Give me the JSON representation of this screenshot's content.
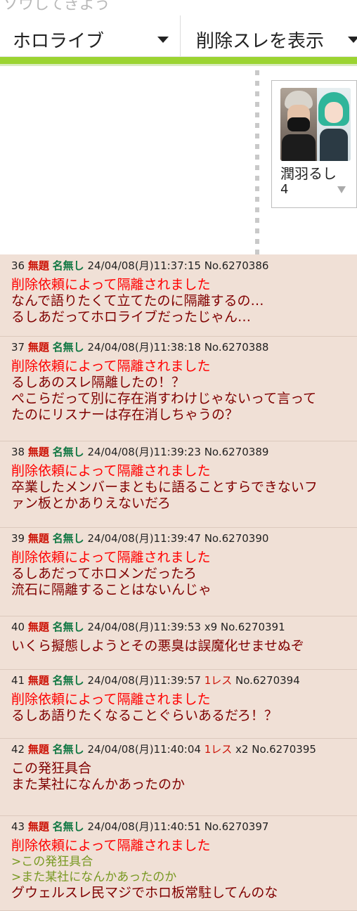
{
  "top_partial_text": "ソウしてきよう",
  "selectors": {
    "board": {
      "label": "ホロライブ"
    },
    "filter": {
      "label": "削除スレを表示"
    }
  },
  "thread_card": {
    "title": "潤羽るし",
    "count": "4"
  },
  "posts": [
    {
      "num": "36",
      "subject": "無題",
      "name": "名無し",
      "datetime": "24/04/08(月)11:37:15",
      "extra": "",
      "postno": "No.6270386",
      "lines": [
        {
          "text": "削除依頼によって隔離されました",
          "type": "warn"
        },
        {
          "text": "なんで語りたくて立てたのに隔離するの…",
          "type": "normal"
        },
        {
          "text": "るしあだってホロライブだったじゃん…",
          "type": "normal"
        }
      ]
    },
    {
      "num": "37",
      "subject": "無題",
      "name": "名無し",
      "datetime": "24/04/08(月)11:38:18",
      "extra": "",
      "postno": "No.6270388",
      "lines": [
        {
          "text": "削除依頼によって隔離されました",
          "type": "warn"
        },
        {
          "text": "るしあのスレ隔離したの！？",
          "type": "normal"
        },
        {
          "text": "ぺこらだって別に存在消すわけじゃないって言って",
          "type": "normal"
        },
        {
          "text": "たのにリスナーは存在消しちゃうの？",
          "type": "normal"
        }
      ]
    },
    {
      "num": "38",
      "subject": "無題",
      "name": "名無し",
      "datetime": "24/04/08(月)11:39:23",
      "extra": "",
      "postno": "No.6270389",
      "lines": [
        {
          "text": "削除依頼によって隔離されました",
          "type": "warn"
        },
        {
          "text": "卒業したメンバーまともに語ることすらできないフ",
          "type": "normal"
        },
        {
          "text": "ァン板とかありえないだろ",
          "type": "normal"
        }
      ]
    },
    {
      "num": "39",
      "subject": "無題",
      "name": "名無し",
      "datetime": "24/04/08(月)11:39:47",
      "extra": "",
      "postno": "No.6270390",
      "lines": [
        {
          "text": "削除依頼によって隔離されました",
          "type": "warn"
        },
        {
          "text": "るしあだってホロメンだったろ",
          "type": "normal"
        },
        {
          "text": "流石に隔離することはないんじゃ",
          "type": "normal"
        }
      ]
    },
    {
      "num": "40",
      "subject": "無題",
      "name": "名無し",
      "datetime": "24/04/08(月)11:39:53",
      "extra": "x9",
      "postno": "No.6270391",
      "lines": [
        {
          "text": "いくら擬態しようとその悪臭は誤魔化せませぬぞ",
          "type": "normal"
        }
      ]
    },
    {
      "num": "41",
      "subject": "無題",
      "name": "名無し",
      "datetime": "24/04/08(月)11:39:57",
      "resp": "1レス",
      "extra": "",
      "postno": "No.6270394",
      "lines": [
        {
          "text": "削除依頼によって隔離されました",
          "type": "warn"
        },
        {
          "text": "るしあ語りたくなることぐらいあるだろ！？",
          "type": "normal"
        }
      ]
    },
    {
      "num": "42",
      "subject": "無題",
      "name": "名無し",
      "datetime": "24/04/08(月)11:40:04",
      "resp": "1レス",
      "extra": "x2",
      "postno": "No.6270395",
      "lines": [
        {
          "text": "この発狂具合",
          "type": "normal"
        },
        {
          "text": "また某社になんかあったのか",
          "type": "normal"
        }
      ]
    },
    {
      "num": "43",
      "subject": "無題",
      "name": "名無し",
      "datetime": "24/04/08(月)11:40:51",
      "extra": "",
      "postno": "No.6270397",
      "lines": [
        {
          "text": "削除依頼によって隔離されました",
          "type": "warn"
        },
        {
          "text": ">この発狂具合",
          "type": "quote"
        },
        {
          "text": ">また某社になんかあったのか",
          "type": "quote"
        },
        {
          "text": "グウェルスレ民マジでホロ板常駐してんのな",
          "type": "normal"
        }
      ]
    }
  ]
}
